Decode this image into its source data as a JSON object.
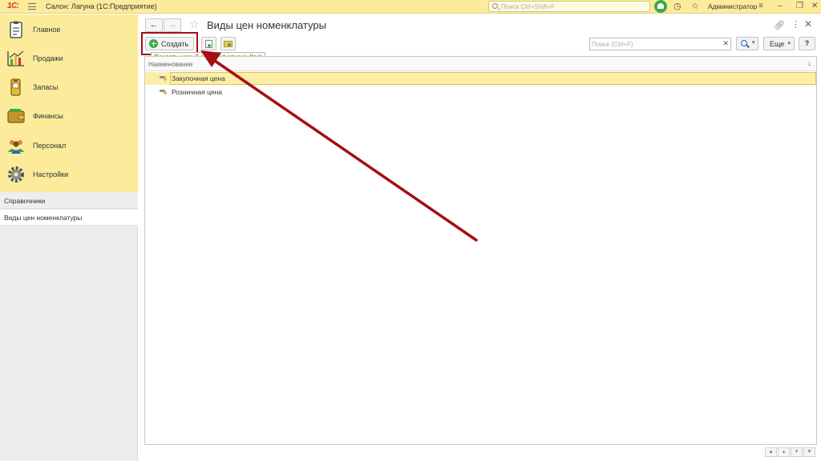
{
  "topbar": {
    "logo": "1С:",
    "app_title": "Салон: Лагуна  (1С:Предприятие)",
    "search_placeholder": "Поиск Ctrl+Shift+F",
    "user_name": "Администратор"
  },
  "sidebar": {
    "sections": [
      {
        "label": "Главное",
        "icon": "clipboard-icon"
      },
      {
        "label": "Продажи",
        "icon": "sales-chart-icon"
      },
      {
        "label": "Запасы",
        "icon": "inventory-icon"
      },
      {
        "label": "Финансы",
        "icon": "wallet-icon"
      },
      {
        "label": "Персонал",
        "icon": "people-icon"
      },
      {
        "label": "Настройки",
        "icon": "gear-icon"
      }
    ],
    "nav_group": "Справочники",
    "nav_item": "Виды цен номенклатуры"
  },
  "main": {
    "title": "Виды цен номенклатуры",
    "create_label": "Создать",
    "tooltip": "Создать новый элемент списка (Ins)",
    "search_placeholder": "Поиск (Ctrl+F)",
    "more_label": "Еще",
    "help_label": "?",
    "column_header": "Наименование",
    "rows": [
      "Закупочная цена",
      "Розничная цена"
    ]
  },
  "colors": {
    "accent_yellow": "#fbeb9b",
    "annotation_red": "#a50f12",
    "green": "#3aaa49"
  }
}
